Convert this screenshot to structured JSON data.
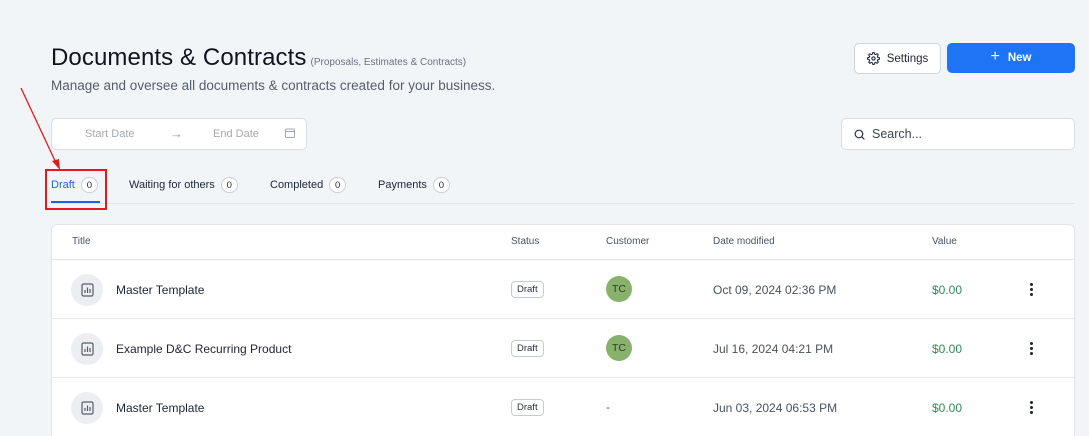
{
  "header": {
    "title": "Documents & Contracts",
    "subtitle": "(Proposals, Estimates & Contracts)",
    "description": "Manage and oversee all documents & contracts created for your business."
  },
  "toolbar": {
    "settings_label": "Settings",
    "new_label": "New",
    "settings_icon": "gear-icon",
    "new_icon": "plus-icon"
  },
  "filters": {
    "start_date_placeholder": "Start Date",
    "end_date_placeholder": "End Date",
    "arrow": "→",
    "search_placeholder": "Search..."
  },
  "tabs": [
    {
      "label": "Draft",
      "count": "0",
      "active": true
    },
    {
      "label": "Waiting for others",
      "count": "0",
      "active": false
    },
    {
      "label": "Completed",
      "count": "0",
      "active": false
    },
    {
      "label": "Payments",
      "count": "0",
      "active": false
    }
  ],
  "table": {
    "columns": [
      "Title",
      "Status",
      "Customer",
      "Date modified",
      "Value"
    ],
    "rows": [
      {
        "title": "Master Template",
        "status": "Draft",
        "customer": "TC",
        "date": "Oct 09, 2024 02:36 PM",
        "value": "$0.00"
      },
      {
        "title": "Example D&C Recurring Product",
        "status": "Draft",
        "customer": "TC",
        "date": "Jul 16, 2024 04:21 PM",
        "value": "$0.00"
      },
      {
        "title": "Master Template",
        "status": "Draft",
        "customer": "-",
        "date": "Jun 03, 2024 06:53 PM",
        "value": "$0.00"
      }
    ]
  },
  "colors": {
    "accent": "#1f74f6",
    "active_tab": "#1f63d8",
    "annotation_red": "#e01b1b",
    "value_green": "#2e8b57",
    "avatar_green": "#88b26c"
  }
}
